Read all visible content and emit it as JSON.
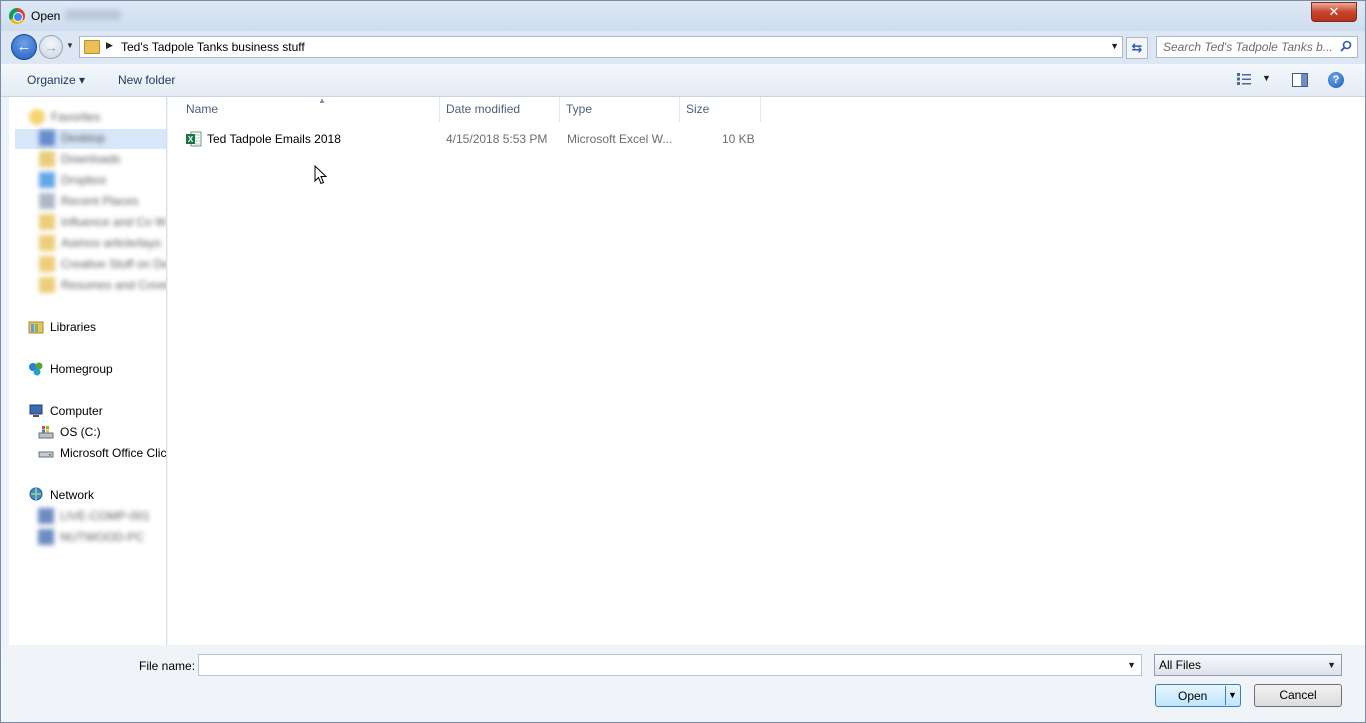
{
  "window": {
    "title": "Open"
  },
  "navigation": {
    "path_segment": "Ted's Tadpole Tanks business stuff",
    "search_placeholder": "Search Ted's Tadpole Tanks b..."
  },
  "toolbar": {
    "organize_label": "Organize ▾",
    "new_folder_label": "New folder"
  },
  "sidebar": {
    "favorites": [
      "Favorites",
      "Desktop",
      "Downloads",
      "Dropbox",
      "Recent Places",
      "Influence and Co W",
      "Asimov article/layo",
      "Creative Stuff on De",
      "Resumes and Cover"
    ],
    "libraries": "Libraries",
    "homegroup": "Homegroup",
    "computer": "Computer",
    "drives": [
      "OS (C:)",
      "Microsoft Office Clic"
    ],
    "network": "Network",
    "network_items": [
      "LIVE-COMP-001",
      "NUTWOOD-PC"
    ]
  },
  "columns": {
    "name": "Name",
    "date_modified": "Date modified",
    "type": "Type",
    "size": "Size"
  },
  "files": [
    {
      "name": "Ted Tadpole Emails 2018",
      "date_modified": "4/15/2018 5:53 PM",
      "type": "Microsoft Excel W...",
      "size": "10 KB",
      "icon": "excel-icon"
    }
  ],
  "footer": {
    "file_name_label": "File name:",
    "file_name_value": "",
    "filter_value": "All Files",
    "open_label": "Open",
    "cancel_label": "Cancel"
  },
  "colors": {
    "accent": "#1f5fbf",
    "excel_green": "#1e7145",
    "close_red": "#c7452d"
  }
}
